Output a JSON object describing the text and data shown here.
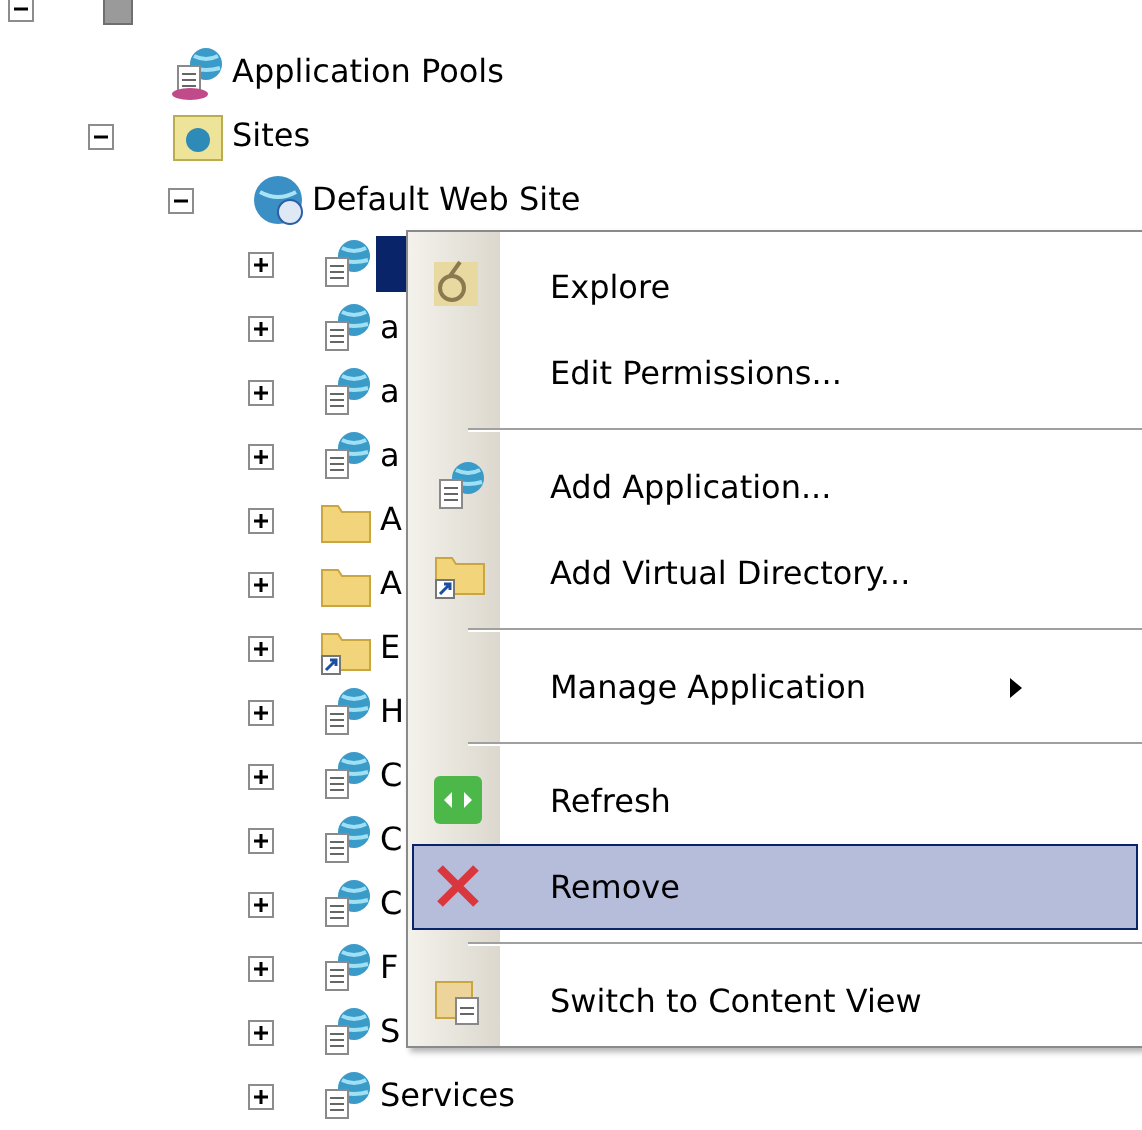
{
  "tree": [
    {
      "kind": "server",
      "expanded": true,
      "children": [
        {
          "kind": "pool",
          "label": "Application Pools"
        },
        {
          "kind": "sites",
          "label": "Sites",
          "expanded": true,
          "children": [
            {
              "kind": "website",
              "label": "Default Web Site",
              "expanded": true,
              "children": [
                {
                  "kind": "app",
                  "expanded": false,
                  "selected": true
                },
                {
                  "kind": "app",
                  "label": "a",
                  "expanded": false,
                  "selected": false
                },
                {
                  "kind": "app",
                  "label": "a",
                  "expanded": false,
                  "selected": false
                },
                {
                  "kind": "app",
                  "label": "a",
                  "expanded": false,
                  "selected": false
                },
                {
                  "kind": "folder",
                  "label": "A",
                  "expanded": false,
                  "selected": false
                },
                {
                  "kind": "folder",
                  "label": "A",
                  "expanded": false,
                  "selected": false
                },
                {
                  "kind": "vdir",
                  "label": "E",
                  "expanded": false,
                  "selected": false
                },
                {
                  "kind": "app",
                  "label": "H",
                  "expanded": false,
                  "selected": false
                },
                {
                  "kind": "app",
                  "label": "C",
                  "expanded": false,
                  "selected": false
                },
                {
                  "kind": "app",
                  "label": "C",
                  "expanded": false,
                  "selected": false
                },
                {
                  "kind": "app",
                  "label": "C",
                  "expanded": false,
                  "selected": false
                },
                {
                  "kind": "app",
                  "label": "F",
                  "expanded": false,
                  "selected": false
                },
                {
                  "kind": "app",
                  "label": "S",
                  "expanded": false,
                  "selected": false
                },
                {
                  "kind": "app",
                  "label": "Services",
                  "expanded": false,
                  "selected": false
                }
              ]
            }
          ]
        }
      ]
    }
  ],
  "context_menu": [
    {
      "kind": "item",
      "label": "Explore",
      "selected": false
    },
    {
      "kind": "item",
      "label": "Edit Permissions...",
      "selected": false
    },
    {
      "kind": "separator"
    },
    {
      "kind": "item",
      "label": "Add Application...",
      "selected": false
    },
    {
      "kind": "item",
      "label": "Add Virtual Directory...",
      "selected": false
    },
    {
      "kind": "separator"
    },
    {
      "kind": "item",
      "label": "Manage Application",
      "submenu": true,
      "selected": false
    },
    {
      "kind": "separator"
    },
    {
      "kind": "item",
      "label": "Refresh",
      "selected": false
    },
    {
      "kind": "item",
      "label": "Remove",
      "selected": true
    },
    {
      "kind": "separator"
    },
    {
      "kind": "item",
      "label": "Switch to Content View",
      "selected": false
    }
  ]
}
